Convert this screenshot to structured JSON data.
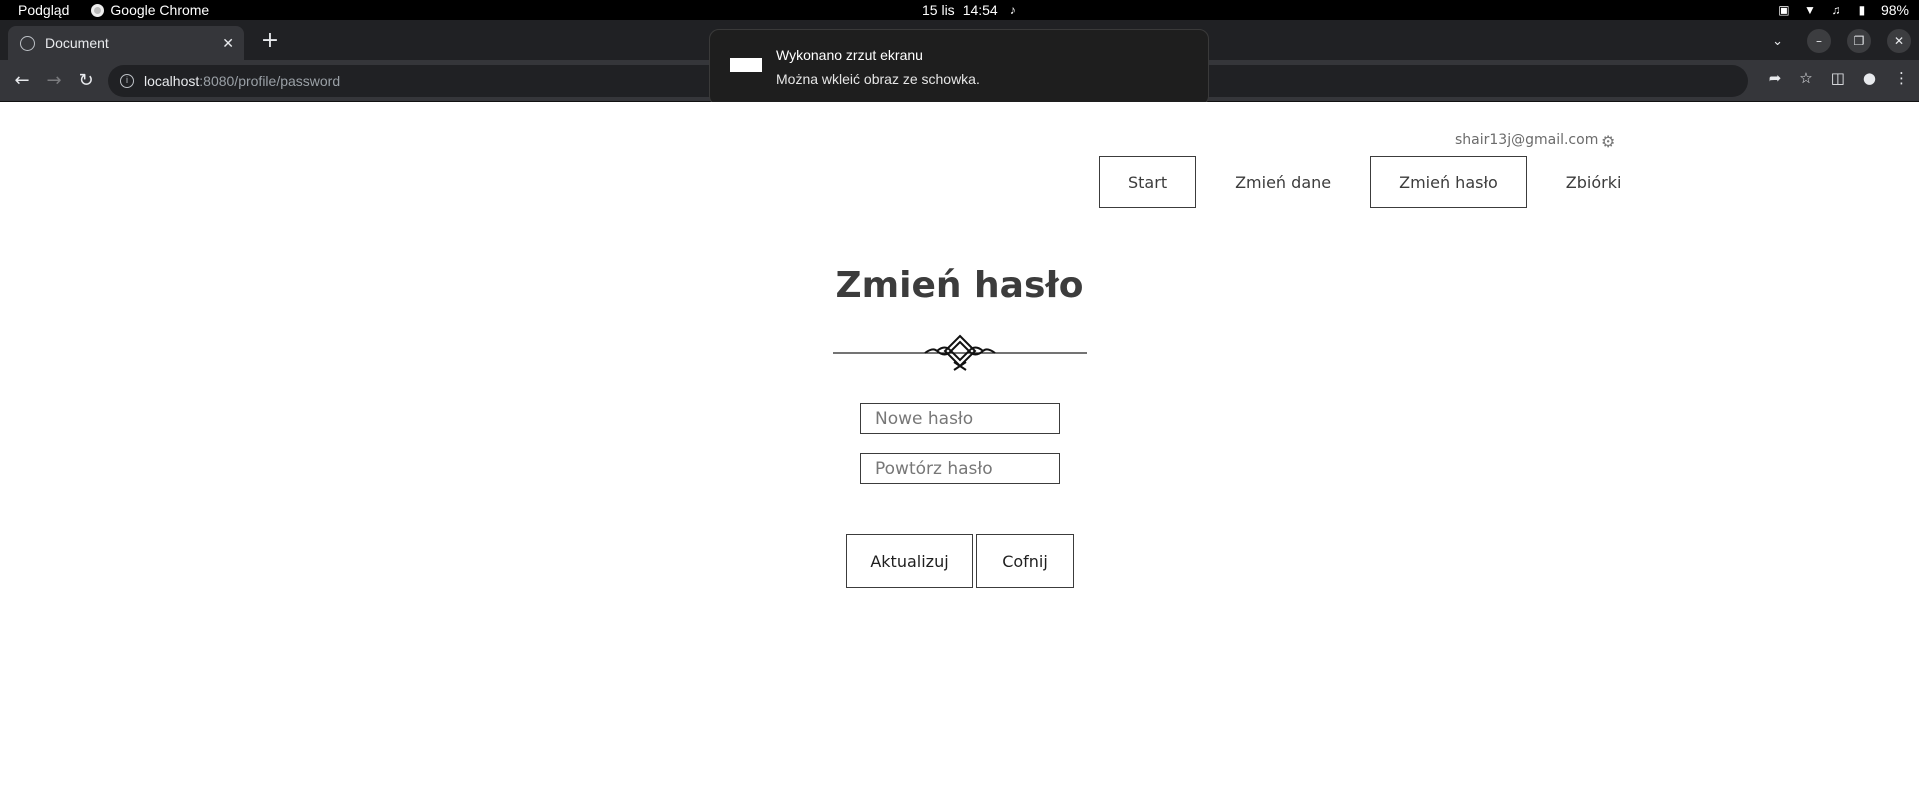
{
  "os": {
    "app_preview": "Podgląd",
    "app_chrome": "Google Chrome",
    "date": "15 lis",
    "time": "14:54",
    "battery": "98%"
  },
  "browser": {
    "tab_title": "Document",
    "url_host": "localhost",
    "url_rest": ":8080/profile/password"
  },
  "notification": {
    "title": "Wykonano zrzut ekranu",
    "body": "Można wkleić obraz ze schowka."
  },
  "page": {
    "user_email": "shair13j@gmail.com",
    "nav": [
      {
        "label": "Start",
        "boxed": true
      },
      {
        "label": "Zmień dane",
        "boxed": false
      },
      {
        "label": "Zmień hasło",
        "boxed": true
      },
      {
        "label": "Zbiórki",
        "boxed": false
      }
    ],
    "heading": "Zmień hasło",
    "new_password_placeholder": "Nowe hasło",
    "repeat_password_placeholder": "Powtórz hasło",
    "update_button": "Aktualizuj",
    "back_button": "Cofnij"
  },
  "icons": {
    "settings": "gear-icon",
    "ornament": "decorative-divider-icon"
  },
  "colors": {
    "text": "#3c3c3c",
    "chrome_dark": "#202124",
    "chrome_toolbar": "#35363a"
  }
}
